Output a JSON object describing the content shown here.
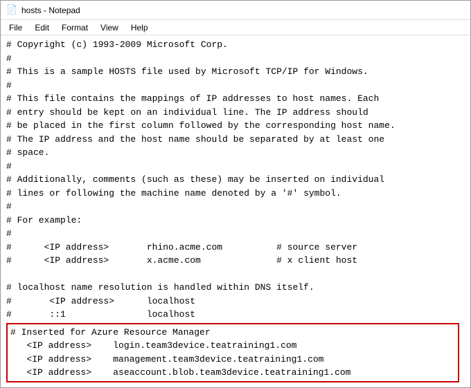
{
  "window": {
    "title": "hosts - Notepad",
    "icon": "📄"
  },
  "menu": {
    "items": [
      "File",
      "Edit",
      "Format",
      "View",
      "Help"
    ]
  },
  "content": {
    "lines": [
      "# Copyright (c) 1993-2009 Microsoft Corp.",
      "#",
      "# This is a sample HOSTS file used by Microsoft TCP/IP for Windows.",
      "#",
      "# This file contains the mappings of IP addresses to host names. Each",
      "# entry should be kept on an individual line. The IP address should",
      "# be placed in the first column followed by the corresponding host name.",
      "# The IP address and the host name should be separated by at least one",
      "# space.",
      "#",
      "# Additionally, comments (such as these) may be inserted on individual",
      "# lines or following the machine name denoted by a '#' symbol.",
      "#",
      "# For example:",
      "#",
      "#      <IP address>       rhino.acme.com          # source server",
      "#      <IP address>       x.acme.com              # x client host",
      "",
      "# localhost name resolution is handled within DNS itself.",
      "#       <IP address>      localhost",
      "#       ::1               localhost"
    ],
    "highlighted": {
      "lines": [
        "# Inserted for Azure Resource Manager",
        "   <IP address>    login.team3device.teatraining1.com",
        "   <IP address>    management.team3device.teatraining1.com",
        "   <IP address>    aseaccount.blob.team3device.teatraining1.com"
      ]
    }
  }
}
